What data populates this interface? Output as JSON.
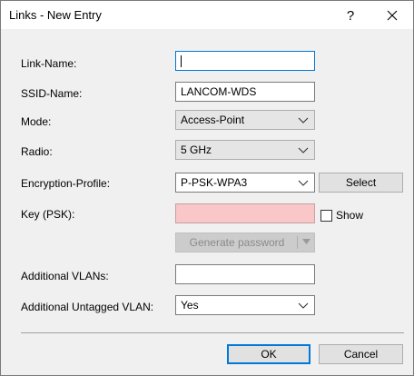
{
  "window": {
    "title": "Links - New Entry",
    "help_label": "?",
    "close_icon": "close-icon"
  },
  "form": {
    "link_name": {
      "label": "Link-Name:",
      "value": ""
    },
    "ssid_name": {
      "label": "SSID-Name:",
      "value": "LANCOM-WDS"
    },
    "mode": {
      "label": "Mode:",
      "value": "Access-Point"
    },
    "radio": {
      "label": "Radio:",
      "value": "5 GHz"
    },
    "encryption_profile": {
      "label": "Encryption-Profile:",
      "value": "P-PSK-WPA3",
      "select_button": "Select"
    },
    "key_psk": {
      "label": "Key (PSK):",
      "value": "",
      "show_label": "Show",
      "show_checked": false,
      "field_color": "#f9c7c7"
    },
    "generate_password": "Generate password",
    "additional_vlans": {
      "label": "Additional VLANs:",
      "value": ""
    },
    "additional_untagged_vlan": {
      "label": "Additional Untagged VLAN:",
      "value": "Yes"
    }
  },
  "footer": {
    "ok_label": "OK",
    "cancel_label": "Cancel"
  },
  "colors": {
    "accent": "#0078d7",
    "dialog_bg": "#f0f0f0"
  }
}
